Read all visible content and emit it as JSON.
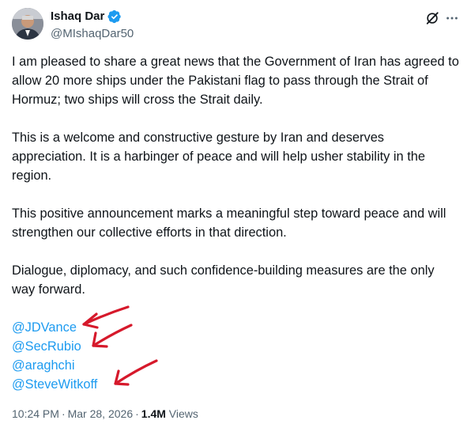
{
  "author": {
    "display_name": "Ishaq Dar",
    "handle": "@MIshaqDar50",
    "avatar_icon": "profile-photo",
    "verified_icon": "verified-badge-icon",
    "verified_color": "#1d9bf0"
  },
  "header_actions": {
    "grok_icon": "grok-icon",
    "more_icon": "more-options-icon"
  },
  "paragraphs": [
    "I am pleased to share a great news that the Government of Iran has agreed to allow 20 more ships under the Pakistani flag to pass through the Strait of Hormuz; two ships will cross the Strait daily.",
    "This is a welcome and constructive gesture by Iran and deserves appreciation. It is a harbinger of peace and will help usher stability in the region.",
    "This positive announcement marks a meaningful step toward peace and will strengthen our collective efforts in that direction.",
    "Dialogue, diplomacy, and such confidence-building measures are the only way forward."
  ],
  "mentions": [
    "@JDVance",
    "@SecRubio",
    "@araghchi",
    "@SteveWitkoff"
  ],
  "annotations": {
    "arrow_color": "#d6192b",
    "arrow_icon": "red-arrow-annotation"
  },
  "meta": {
    "time": "10:24 PM",
    "separator": "·",
    "date": "Mar 28, 2026",
    "views_count": "1.4M",
    "views_label": "Views"
  },
  "colors": {
    "text": "#0f1419",
    "secondary": "#536471",
    "link": "#1d9bf0"
  }
}
